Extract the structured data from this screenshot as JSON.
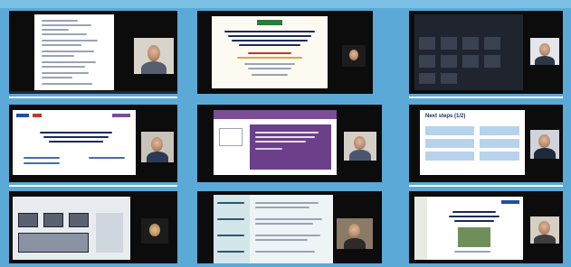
{
  "meeting": {
    "tiles": [
      {
        "slide_title": "",
        "participant": "participant-1"
      },
      {
        "slide_title": "",
        "participant": "participant-2"
      },
      {
        "slide_title": "",
        "participant": "participant-3"
      },
      {
        "slide_title": "",
        "participant": "participant-4"
      },
      {
        "slide_title": "",
        "participant": "participant-5"
      },
      {
        "slide_title": "Next steps (1/2)",
        "participant": "participant-6"
      },
      {
        "slide_title": "",
        "participant": "participant-7"
      },
      {
        "slide_title": "",
        "participant": "participant-8"
      },
      {
        "slide_title": "",
        "participant": "participant-9"
      }
    ]
  },
  "colors": {
    "background": "#5aa9d6",
    "tile": "#0c0c0c",
    "slide_purple": "#7a4d95",
    "title_navy": "#1b2a5a"
  }
}
